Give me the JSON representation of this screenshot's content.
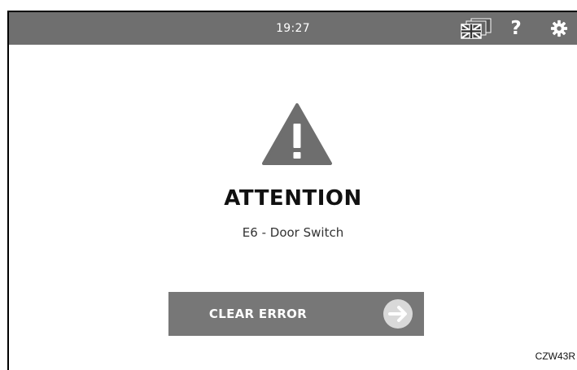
{
  "status_bar": {
    "time": "19:27",
    "icons": {
      "language": "uk-flag-icon",
      "help": "question-mark-icon",
      "settings": "gear-icon"
    },
    "help_glyph": "?"
  },
  "alert": {
    "icon": "warning-triangle-icon",
    "title": "ATTENTION",
    "message": "E6 - Door Switch"
  },
  "actions": {
    "clear_error_label": "CLEAR ERROR",
    "clear_error_icon": "arrow-right-circle-icon"
  },
  "figure_code": "CZW43R",
  "colors": {
    "topbar": "#6f6f6f",
    "button": "#777777",
    "warning": "#6e6e6e",
    "text": "#111111"
  }
}
